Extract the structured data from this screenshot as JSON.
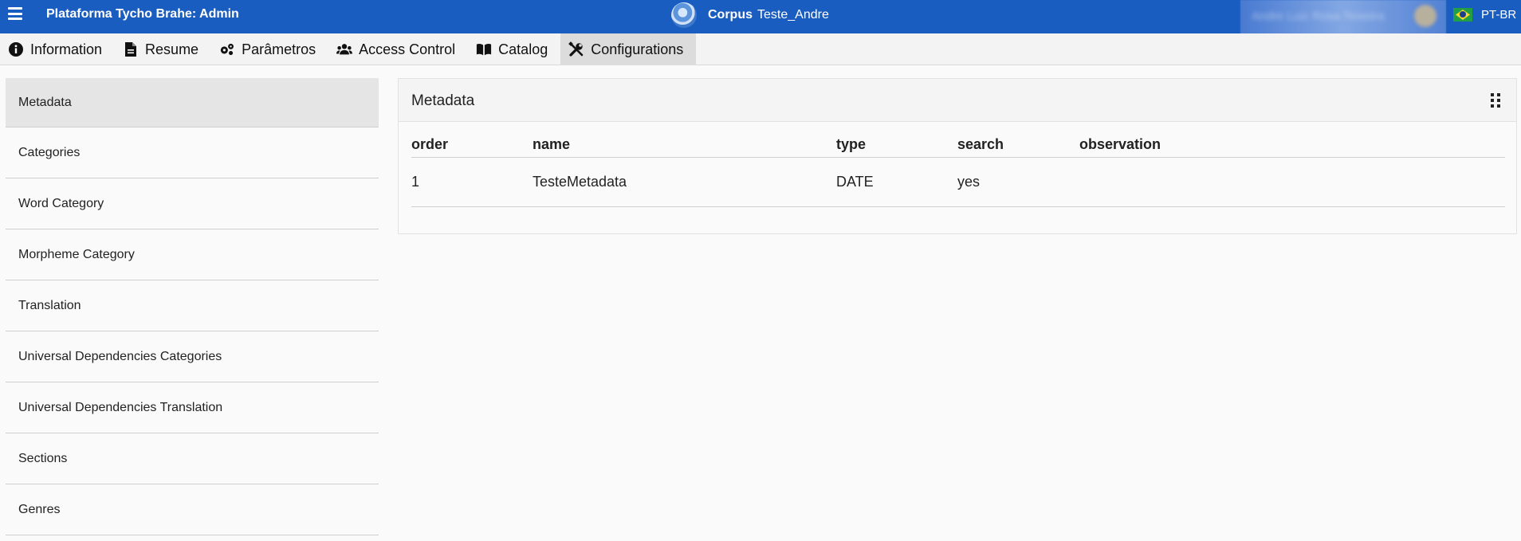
{
  "header": {
    "app_title": "Plataforma Tycho Brahe: Admin",
    "corpus_label": "Corpus",
    "corpus_name": "Teste_Andre",
    "user_name": "Andre Luiz Rosa Teixeira",
    "language": "PT-BR"
  },
  "tabs": [
    {
      "label": "Information",
      "icon": "info-icon"
    },
    {
      "label": "Resume",
      "icon": "document-icon"
    },
    {
      "label": "Parâmetros",
      "icon": "gears-icon"
    },
    {
      "label": "Access Control",
      "icon": "users-icon"
    },
    {
      "label": "Catalog",
      "icon": "book-icon"
    },
    {
      "label": "Configurations",
      "icon": "tools-icon",
      "active": true
    }
  ],
  "sidebar": {
    "items": [
      {
        "label": "Metadata",
        "active": true
      },
      {
        "label": "Categories"
      },
      {
        "label": "Word Category"
      },
      {
        "label": "Morpheme Category"
      },
      {
        "label": "Translation"
      },
      {
        "label": "Universal Dependencies Categories"
      },
      {
        "label": "Universal Dependencies Translation"
      },
      {
        "label": "Sections"
      },
      {
        "label": "Genres"
      }
    ]
  },
  "panel": {
    "title": "Metadata",
    "columns": [
      "order",
      "name",
      "type",
      "search",
      "observation"
    ],
    "rows": [
      [
        "1",
        "TesteMetadata",
        "DATE",
        "yes",
        ""
      ]
    ]
  }
}
